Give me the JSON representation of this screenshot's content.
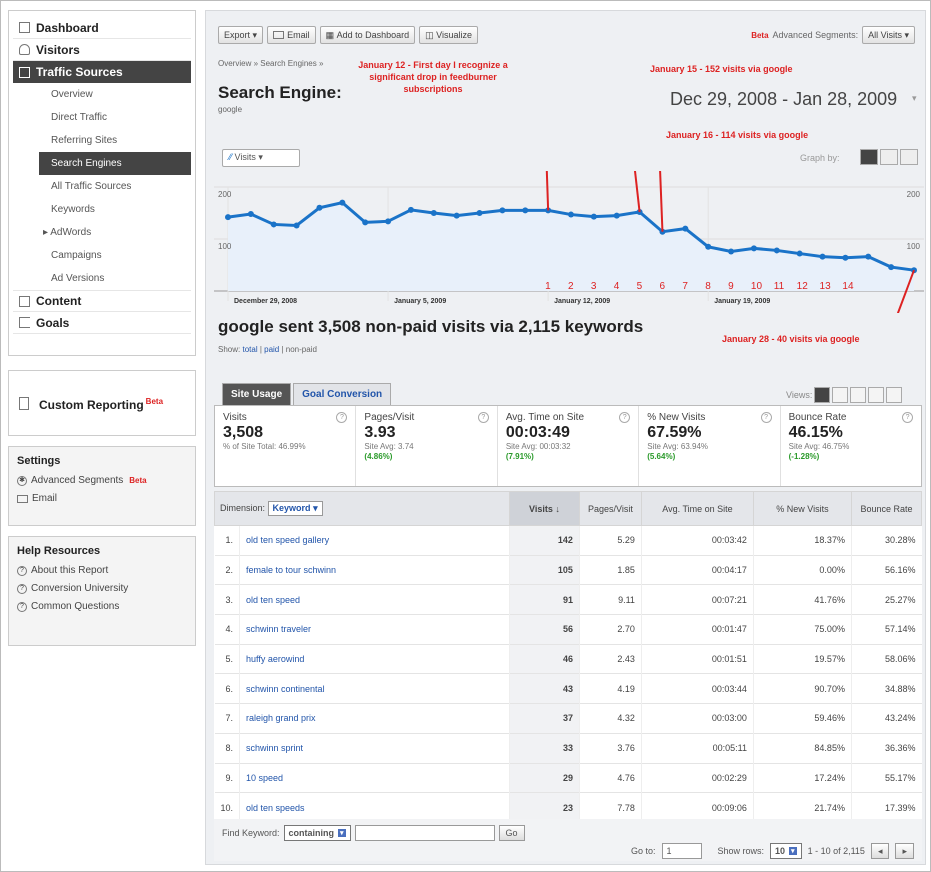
{
  "sidebar": {
    "nav": [
      {
        "label": "Dashboard",
        "icon": "grid-icon",
        "active": false
      },
      {
        "label": "Visitors",
        "icon": "person-icon",
        "active": false
      },
      {
        "label": "Traffic Sources",
        "icon": "traffic-icon",
        "active": true
      }
    ],
    "traffic_subitems": [
      "Overview",
      "Direct Traffic",
      "Referring Sites",
      "Search Engines",
      "All Traffic Sources",
      "Keywords",
      "AdWords",
      "Campaigns",
      "Ad Versions"
    ],
    "nav_bottom": [
      {
        "label": "Content",
        "icon": "page-icon"
      },
      {
        "label": "Goals",
        "icon": "flag-icon"
      }
    ],
    "custom_reporting": "Custom Reporting",
    "beta": "Beta",
    "settings_title": "Settings",
    "settings_items": [
      "Advanced Segments",
      "Email"
    ],
    "help_title": "Help Resources",
    "help_items": [
      "About this Report",
      "Conversion University",
      "Common Questions"
    ]
  },
  "toolbar": {
    "export": "Export",
    "email": "Email",
    "add_to_dashboard": "Add to Dashboard",
    "visualize": "Visualize",
    "beta": "Beta",
    "advanced_segments": "Advanced Segments:",
    "segment_value": "All Visits"
  },
  "report": {
    "breadcrumb": "Overview » Search Engines »",
    "title": "Search Engine:",
    "subtitle": "google",
    "date_range": "Dec 29, 2008 - Jan 28, 2009",
    "metric_selector": "Visits",
    "graph_by": "Graph by:",
    "headline": "google sent 3,508 non-paid visits via 2,115 keywords",
    "show_label": "Show:",
    "show_options": [
      "total",
      "paid",
      "non-paid"
    ]
  },
  "annotations": {
    "jan12": "January 12 - First day I recognize a significant drop in feedburner subscriptions",
    "jan15": "January 15 - 152 visits via google",
    "jan16": "January 16 - 114 visits via google",
    "jan28": "January 28 - 40 visits via google"
  },
  "chart_data": {
    "type": "line",
    "x": [
      "2008-12-29",
      "2008-12-30",
      "2008-12-31",
      "2009-01-01",
      "2009-01-02",
      "2009-01-03",
      "2009-01-04",
      "2009-01-05",
      "2009-01-06",
      "2009-01-07",
      "2009-01-08",
      "2009-01-09",
      "2009-01-10",
      "2009-01-11",
      "2009-01-12",
      "2009-01-13",
      "2009-01-14",
      "2009-01-15",
      "2009-01-16",
      "2009-01-17",
      "2009-01-18",
      "2009-01-19",
      "2009-01-20",
      "2009-01-21",
      "2009-01-22",
      "2009-01-23",
      "2009-01-24",
      "2009-01-25",
      "2009-01-26",
      "2009-01-27",
      "2009-01-28"
    ],
    "series": [
      {
        "name": "Visits",
        "values": [
          142,
          148,
          128,
          126,
          160,
          170,
          132,
          134,
          156,
          150,
          145,
          150,
          155,
          155,
          155,
          147,
          143,
          145,
          152,
          114,
          120,
          85,
          76,
          82,
          78,
          72,
          66,
          64,
          66,
          46,
          40
        ]
      }
    ],
    "ylim": [
      0,
      200
    ],
    "yticks": [
      "200",
      "100"
    ],
    "xticks": [
      "December 29, 2008",
      "January 5, 2009",
      "January 12, 2009",
      "January 19, 2009"
    ],
    "day_numbers": [
      "1",
      "2",
      "3",
      "4",
      "5",
      "6",
      "7",
      "8",
      "9",
      "10",
      "11",
      "12",
      "13",
      "14"
    ],
    "grid": true,
    "color": "#1a73c8"
  },
  "tabs": [
    "Site Usage",
    "Goal Conversion"
  ],
  "views_label": "Views:",
  "scorecard": [
    {
      "name": "Visits",
      "value": "3,508",
      "note": "% of Site Total: 46.99%",
      "pct": ""
    },
    {
      "name": "Pages/Visit",
      "value": "3.93",
      "note": "Site Avg: 3.74",
      "pct": "(4.86%)"
    },
    {
      "name": "Avg. Time on Site",
      "value": "00:03:49",
      "note": "Site Avg: 00:03:32",
      "pct": "(7.91%)"
    },
    {
      "name": "% New Visits",
      "value": "67.59%",
      "note": "Site Avg: 63.94%",
      "pct": "(5.64%)"
    },
    {
      "name": "Bounce Rate",
      "value": "46.15%",
      "note": "Site Avg: 46.75%",
      "pct": "(-1.28%)"
    }
  ],
  "table": {
    "dimension_label": "Dimension:",
    "dimension_value": "Keyword",
    "columns": [
      "Visits ↓",
      "Pages/Visit",
      "Avg. Time on Site",
      "% New Visits",
      "Bounce Rate"
    ],
    "rows": [
      {
        "idx": "1.",
        "keyword": "old ten speed gallery",
        "visits": "142",
        "ppv": "5.29",
        "time": "00:03:42",
        "new": "18.37%",
        "bounce": "30.28%"
      },
      {
        "idx": "2.",
        "keyword": "female to tour schwinn",
        "visits": "105",
        "ppv": "1.85",
        "time": "00:04:17",
        "new": "0.00%",
        "bounce": "56.16%"
      },
      {
        "idx": "3.",
        "keyword": "old ten speed",
        "visits": "91",
        "ppv": "9.11",
        "time": "00:07:21",
        "new": "41.76%",
        "bounce": "25.27%"
      },
      {
        "idx": "4.",
        "keyword": "schwinn traveler",
        "visits": "56",
        "ppv": "2.70",
        "time": "00:01:47",
        "new": "75.00%",
        "bounce": "57.14%"
      },
      {
        "idx": "5.",
        "keyword": "huffy aerowind",
        "visits": "46",
        "ppv": "2.43",
        "time": "00:01:51",
        "new": "19.57%",
        "bounce": "58.06%"
      },
      {
        "idx": "6.",
        "keyword": "schwinn continental",
        "visits": "43",
        "ppv": "4.19",
        "time": "00:03:44",
        "new": "90.70%",
        "bounce": "34.88%"
      },
      {
        "idx": "7.",
        "keyword": "raleigh grand prix",
        "visits": "37",
        "ppv": "4.32",
        "time": "00:03:00",
        "new": "59.46%",
        "bounce": "43.24%"
      },
      {
        "idx": "8.",
        "keyword": "schwinn sprint",
        "visits": "33",
        "ppv": "3.76",
        "time": "00:05:11",
        "new": "84.85%",
        "bounce": "36.36%"
      },
      {
        "idx": "9.",
        "keyword": "10 speed",
        "visits": "29",
        "ppv": "4.76",
        "time": "00:02:29",
        "new": "17.24%",
        "bounce": "55.17%"
      },
      {
        "idx": "10.",
        "keyword": "old ten speeds",
        "visits": "23",
        "ppv": "7.78",
        "time": "00:09:06",
        "new": "21.74%",
        "bounce": "17.39%"
      }
    ]
  },
  "footer": {
    "find_keyword": "Find Keyword:",
    "filter_mode": "containing",
    "go": "Go",
    "goto": "Go to:",
    "goto_value": "1",
    "show_rows": "Show rows:",
    "rows_value": "10",
    "pagination": "1 - 10 of 2,115"
  }
}
